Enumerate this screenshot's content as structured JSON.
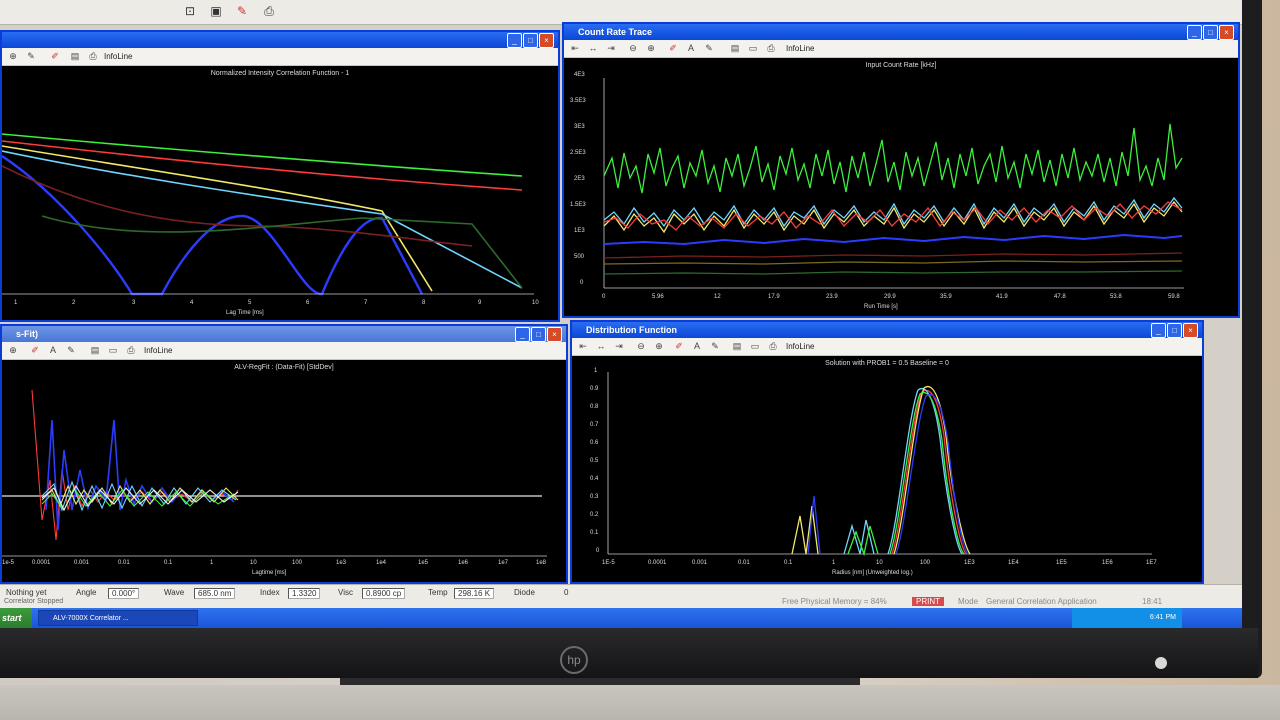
{
  "app": {
    "top_toolbar_icons": [
      "zoom-icon",
      "select-icon",
      "pen-icon",
      "print-icon"
    ]
  },
  "windows": {
    "top_left": {
      "title": "",
      "info": "InfoLine",
      "plot_title": "Normalized Intensity Correlation Function - 1",
      "xlabel": "Lag Time [ms]",
      "x_ticks": [
        "1",
        "2",
        "3",
        "4",
        "5",
        "6",
        "7",
        "8",
        "9",
        "10"
      ]
    },
    "top_right": {
      "title": "Count Rate Trace",
      "info": "InfoLine",
      "plot_title": "Input Count Rate [kHz]",
      "xlabel": "Run Time [s]",
      "y_ticks": [
        "4E3",
        "3.5E3",
        "3E3",
        "2.5E3",
        "2E3",
        "1.5E3",
        "1E3",
        "500",
        "0"
      ],
      "x_ticks": [
        "0",
        "5.96",
        "12",
        "17.9",
        "23.9",
        "29.9",
        "35.9",
        "41.9",
        "47.8",
        "53.8",
        "59.8"
      ]
    },
    "bottom_left": {
      "title": "s-Fit)",
      "info": "InfoLine",
      "plot_title": "ALV-RegFit : (Data-Fit) [StdDev]",
      "xlabel": "Lagtime [ms]",
      "x_ticks": [
        "1e-5",
        "0.0001",
        "0.001",
        "0.01",
        "0.1",
        "1",
        "10",
        "100",
        "1e3",
        "1e4",
        "1e5",
        "1e6",
        "1e7",
        "1e8"
      ]
    },
    "bottom_right": {
      "title": "Distribution Function",
      "info": "InfoLine",
      "plot_title": "Solution with PROB1 = 0.5 Baseline = 0",
      "xlabel": "Radius [nm] (Unweighted log.)",
      "y_ticks": [
        "1",
        "0.9",
        "0.8",
        "0.7",
        "0.6",
        "0.5",
        "0.4",
        "0.3",
        "0.2",
        "0.1",
        "0"
      ],
      "x_ticks": [
        "1E-5",
        "0.0001",
        "0.001",
        "0.01",
        "0.1",
        "1",
        "10",
        "100",
        "1E3",
        "1E4",
        "1E5",
        "1E6",
        "1E7"
      ]
    }
  },
  "status": {
    "state": "Nothing yet",
    "sub_state": "Correlator Stopped",
    "angle_label": "Angle",
    "angle_value": "0.000°",
    "wave_label": "Wave",
    "wave_value": "685.0 nm",
    "index_label": "Index",
    "index_value": "1.3320",
    "visc_label": "Visc",
    "visc_value": "0.8900 cp",
    "temp_label": "Temp",
    "temp_value": "298.16 K",
    "diode_label": "Diode",
    "diode_value": "0",
    "memory": "Free Physical Memory = 84%",
    "print": "PRINT",
    "mode_label": "Mode",
    "mode_value": "General Correlation Application",
    "clock_small": "18:41"
  },
  "taskbar": {
    "start": "start",
    "task": "ALV-7000X Correlator ...",
    "clock": "6:41 PM"
  },
  "colors": {
    "title_active": "#0a47d6",
    "plot_bg": "#000000",
    "green": "#3cf03c",
    "red": "#ff3a3a",
    "yellow": "#f2e86a",
    "cyan": "#6fd6ff",
    "blue": "#2b3cff"
  }
}
